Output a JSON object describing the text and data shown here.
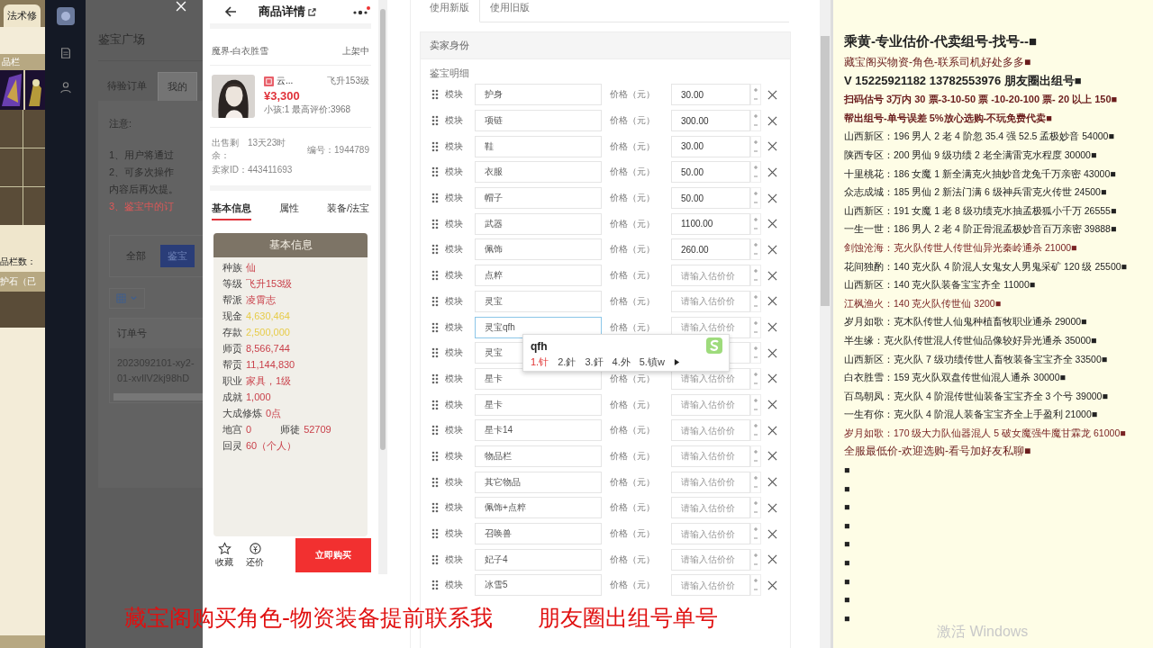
{
  "game_panel": {
    "tab": "法术修",
    "bar_label": "品栏",
    "count_label": "品栏数：",
    "stone_label": "护石（已"
  },
  "admin": {
    "title": "鉴宝广场",
    "tabs": [
      {
        "label": "待验订单",
        "selected": false
      },
      {
        "label": "我的",
        "selected": true
      }
    ],
    "notes": [
      {
        "text": "注意:",
        "kind": "plain"
      },
      {
        "text": "1、用户将通过",
        "kind": "plain"
      },
      {
        "text": "2、可多次操作",
        "kind": "plain"
      },
      {
        "text": "内容后再次提。",
        "kind": "plain"
      },
      {
        "text": "3、鉴宝中的订",
        "kind": "warning"
      }
    ],
    "filters": [
      {
        "label": "全部",
        "selected": false
      },
      {
        "label": "鉴宝",
        "selected": true
      }
    ],
    "table": {
      "columns": [
        "订单号"
      ],
      "rows": [
        [
          "2023092101-xy2-01-xvIlV2kj98hD"
        ]
      ]
    }
  },
  "phone": {
    "title": "商品详情",
    "server": "魔界-白衣胜雪",
    "status": "上架中",
    "item": {
      "name": "云...",
      "level": "飞升153级",
      "price": "¥3,300",
      "meta": "小孩:1 最高评价:3968"
    },
    "sale": [
      {
        "label": "出售剩余：",
        "value": "13天23时"
      },
      {
        "label": "卖家ID：",
        "value": "443411693"
      }
    ],
    "serial": "编号：1944789",
    "tabs": [
      {
        "label": "基本信息",
        "selected": true
      },
      {
        "label": "属性",
        "selected": false
      },
      {
        "label": "装备/法宝",
        "selected": false
      }
    ],
    "card": {
      "title": "基本信息",
      "rows": [
        {
          "label": "种族",
          "value": "仙",
          "kind": "red"
        },
        {
          "label": "等级",
          "value": "飞升153级",
          "kind": "red"
        },
        {
          "label": "帮派",
          "value": "凌霄志",
          "kind": "red"
        },
        {
          "label": "现金",
          "value": "4,630,464",
          "kind": "gold"
        },
        {
          "label": "存款",
          "value": "2,500,000",
          "kind": "gold"
        },
        {
          "label": "师贡",
          "value": "8,566,744",
          "kind": "red"
        },
        {
          "label": "帮贡",
          "value": "11,144,830",
          "kind": "red"
        },
        {
          "label": "职业",
          "value": "家具，1级",
          "kind": "red"
        },
        {
          "label": "成就",
          "value": "1,000",
          "kind": "red"
        },
        {
          "label": "大成修炼",
          "value": "0点",
          "kind": "red"
        },
        {
          "label": "地宫",
          "value": "0",
          "kind": "red",
          "extra_label": "师徒",
          "extra_value": "52709"
        },
        {
          "label": "回灵",
          "value": "60（个人）",
          "kind": "red"
        }
      ]
    },
    "footer": {
      "actions": [
        {
          "label": "收藏",
          "kind": "star"
        },
        {
          "label": "还价",
          "kind": "coin"
        }
      ],
      "buy": "立即购买"
    }
  },
  "form": {
    "tabs": [
      {
        "label": "使用新版",
        "selected": true
      },
      {
        "label": "使用旧版",
        "selected": false
      }
    ],
    "section": "卖家身份",
    "subsection": "鉴宝明细",
    "rows": [
      {
        "module": "模块",
        "name": "护身",
        "price_label": "价格（元）",
        "price": "30.00",
        "focused": false
      },
      {
        "module": "模块",
        "name": "项链",
        "price_label": "价格（元）",
        "price": "300.00",
        "focused": false
      },
      {
        "module": "模块",
        "name": "鞋",
        "price_label": "价格（元）",
        "price": "30.00",
        "focused": false
      },
      {
        "module": "模块",
        "name": "衣服",
        "price_label": "价格（元）",
        "price": "50.00",
        "focused": false
      },
      {
        "module": "模块",
        "name": "帽子",
        "price_label": "价格（元）",
        "price": "50.00",
        "focused": false
      },
      {
        "module": "模块",
        "name": "武器",
        "price_label": "价格（元）",
        "price": "1100.00",
        "focused": false
      },
      {
        "module": "模块",
        "name": "佩饰",
        "price_label": "价格（元）",
        "price": "260.00",
        "focused": false
      },
      {
        "module": "模块",
        "name": "点粹",
        "price_label": "价格（元）",
        "placeholder": "请输入估价价",
        "focused": false
      },
      {
        "module": "模块",
        "name": "灵宝",
        "price_label": "价格（元）",
        "placeholder": "请输入估价价",
        "focused": false
      },
      {
        "module": "模块",
        "name": "灵宝qfh",
        "price_label": "价格（元）",
        "placeholder": "请输入估价价",
        "focused": true
      },
      {
        "module": "模块",
        "name": "灵宝",
        "focused": false
      },
      {
        "module": "模块",
        "name": "星卡",
        "price_label": "价格（元）",
        "placeholder": "请输入估价价",
        "focused": false
      },
      {
        "module": "模块",
        "name": "星卡",
        "price_label": "价格（元）",
        "placeholder": "请输入估价价",
        "focused": false
      },
      {
        "module": "模块",
        "name": "星卡14",
        "price_label": "价格（元）",
        "placeholder": "请输入估价价",
        "focused": false
      },
      {
        "module": "模块",
        "name": "物品栏",
        "price_label": "价格（元）",
        "placeholder": "请输入估价价",
        "focused": false
      },
      {
        "module": "模块",
        "name": "其它物品",
        "price_label": "价格（元）",
        "placeholder": "请输入估价价",
        "focused": false
      },
      {
        "module": "模块",
        "name": "佩饰+点粹",
        "price_label": "价格（元）",
        "placeholder": "请输入估价价",
        "focused": false
      },
      {
        "module": "模块",
        "name": "召唤兽",
        "price_label": "价格（元）",
        "placeholder": "请输入估价价",
        "focused": false
      },
      {
        "module": "模块",
        "name": "妃子4",
        "price_label": "价格（元）",
        "placeholder": "请输入估价价",
        "focused": false
      },
      {
        "module": "模块",
        "name": "冰雪5",
        "price_label": "价格（元）",
        "placeholder": "请输入估价价",
        "focused": false
      }
    ],
    "ime": {
      "input": "qfh",
      "candidates": [
        {
          "text": "1.针",
          "selected": true
        },
        {
          "text": "2.針",
          "selected": false
        },
        {
          "text": "3.釬",
          "selected": false
        },
        {
          "text": "4.外",
          "selected": false
        },
        {
          "text": "5.镇w",
          "selected": false
        }
      ]
    }
  },
  "notice": {
    "lines": [
      {
        "text": "乘黄-专业估价-代卖组号-找号--■",
        "kind": "title"
      },
      {
        "text": "藏宝阁买物资-角色-联系司机好处多多■",
        "kind": "ad"
      },
      {
        "text": "V 15225921182   13782553976 朋友圈出组号■",
        "kind": "contact"
      },
      {
        "text": "扫码估号 3万内 30 票-3-10-50 票  -10-20-100 票- 20 以上 150■",
        "kind": "promo"
      },
      {
        "text": "帮出组号-单号误差 5%放心选购-不玩免费代卖■",
        "kind": "promo"
      },
      {
        "text": "山西新区：196 男人 2 老 4 阶忽 35.4 强 52.5 孟极妙音 54000■",
        "kind": "listing"
      },
      {
        "text": "陕西专区：200 男仙 9 级功绩 2 老全满雷克水程度 30000■",
        "kind": "listing"
      },
      {
        "text": "十里桃花：186 女魔 1 新全满克火抽妙音龙兔千万亲密 43000■",
        "kind": "listing"
      },
      {
        "text": "众志成城：185 男仙 2 新法门满 6 级神兵雷克火传世 24500■",
        "kind": "listing"
      },
      {
        "text": "山西新区：191 女魔 1 老 8 级功绩克水抽孟极狐小千万 26555■",
        "kind": "listing"
      },
      {
        "text": "一生一世：186 男人 2 老 4 阶正骨混孟极妙音百万亲密 39888■",
        "kind": "listing"
      },
      {
        "text": "剑蚀沧海：克火队传世人传世仙异光秦岭通杀 21000■",
        "kind": "highlight"
      },
      {
        "text": "花间独酌：140 克火队 4 阶混人女鬼女人男鬼采矿 120 级 25500■",
        "kind": "listing"
      },
      {
        "text": "山西新区：140 克火队装备宝宝齐全 11000■",
        "kind": "listing"
      },
      {
        "text": "江枫渔火：140 克火队传世仙 3200■",
        "kind": "highlight"
      },
      {
        "text": "岁月如歌：克木队传世人仙鬼种植畜牧职业通杀 29000■",
        "kind": "listing"
      },
      {
        "text": "半生缘：克火队传世混人传世仙品像较好异光通杀 35000■",
        "kind": "listing"
      },
      {
        "text": "山西新区：克火队 7 级功绩传世人畜牧装备宝宝齐全 33500■",
        "kind": "listing"
      },
      {
        "text": "白衣胜雪：159 克火队双盘传世仙混人通杀 30000■",
        "kind": "listing"
      },
      {
        "text": "百鸟朝凤：克火队 4 阶混传世仙装备宝宝齐全 3 个号 39000■",
        "kind": "listing"
      },
      {
        "text": "一生有你：克火队 4 阶混人装备宝宝齐全上手盈利 21000■",
        "kind": "listing"
      },
      {
        "text": "岁月如歌：170 级大力队仙器混人 5 破女魔强牛魔甘霖龙 61000■",
        "kind": "highlight"
      },
      {
        "text": "全服最低价-欢迎选购-看号加好友私聊■",
        "kind": "ad"
      },
      {
        "text": "■",
        "kind": "listing"
      },
      {
        "text": "■",
        "kind": "listing"
      },
      {
        "text": "■",
        "kind": "listing"
      },
      {
        "text": "■",
        "kind": "listing"
      },
      {
        "text": "■",
        "kind": "listing"
      },
      {
        "text": "■",
        "kind": "listing"
      },
      {
        "text": "■",
        "kind": "listing"
      },
      {
        "text": "■",
        "kind": "listing"
      },
      {
        "text": "■",
        "kind": "listing"
      }
    ]
  },
  "caption": [
    "藏宝阁购买角色-物资装备提前联系我",
    "朋友圈出组号单号"
  ],
  "watermark": "激活 Windows"
}
